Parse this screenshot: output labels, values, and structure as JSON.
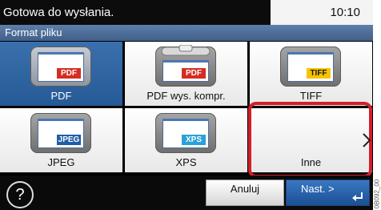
{
  "status": {
    "message": "Gotowa do wysłania.",
    "time": "10:10"
  },
  "section": {
    "title": "Format pliku"
  },
  "formats": [
    {
      "label": "PDF",
      "badge": "PDF",
      "selected": true
    },
    {
      "label": "PDF wys. kompr.",
      "badge": "PDF",
      "selected": false
    },
    {
      "label": "TIFF",
      "badge": "TIFF",
      "selected": false
    },
    {
      "label": "JPEG",
      "badge": "JPEG",
      "selected": false
    },
    {
      "label": "XPS",
      "badge": "XPS",
      "selected": false
    },
    {
      "label": "Inne",
      "badge": "",
      "selected": false
    }
  ],
  "footer": {
    "help": "?",
    "cancel": "Anuluj",
    "next": "Nast. >"
  },
  "side_code": "0B092_00",
  "colors": {
    "highlight": "#d21f28",
    "selected_tile": "#2f66a3",
    "pdf_badge": "#d42d23",
    "tiff_badge": "#f6c400",
    "jpeg_badge": "#1f5ea6",
    "xps_badge": "#2aa2d8"
  },
  "icons": [
    "help-icon",
    "chevron-right-icon",
    "enter-icon"
  ]
}
